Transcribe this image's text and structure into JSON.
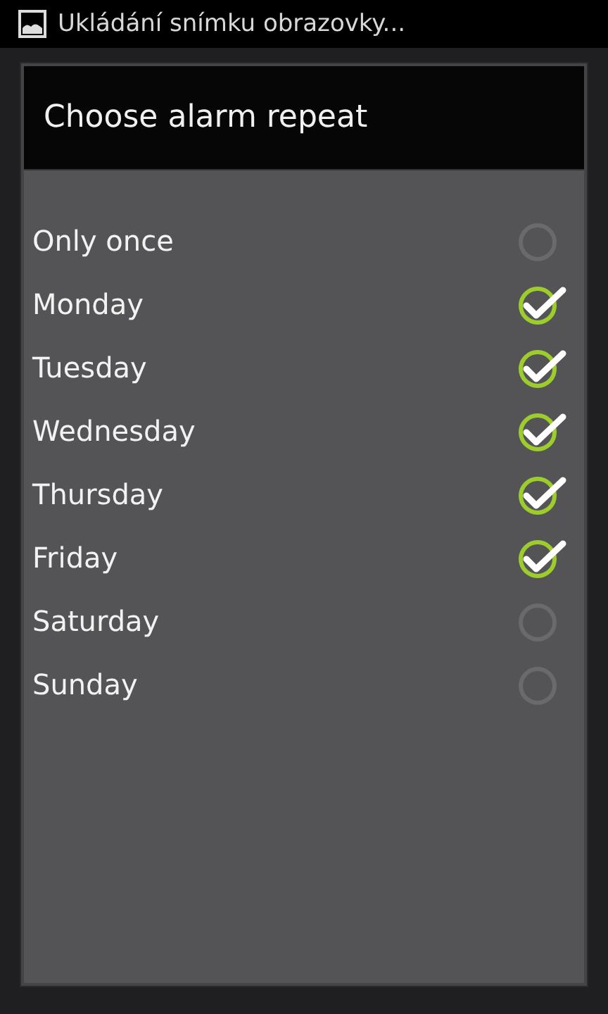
{
  "status_bar": {
    "notification": "Ukládání snímku obrazovky..."
  },
  "dialog": {
    "title": "Choose alarm repeat",
    "options": [
      {
        "label": "Only once",
        "checked": false
      },
      {
        "label": "Monday",
        "checked": true
      },
      {
        "label": "Tuesday",
        "checked": true
      },
      {
        "label": "Wednesday",
        "checked": true
      },
      {
        "label": "Thursday",
        "checked": true
      },
      {
        "label": "Friday",
        "checked": true
      },
      {
        "label": "Saturday",
        "checked": false
      },
      {
        "label": "Sunday",
        "checked": false
      }
    ]
  }
}
